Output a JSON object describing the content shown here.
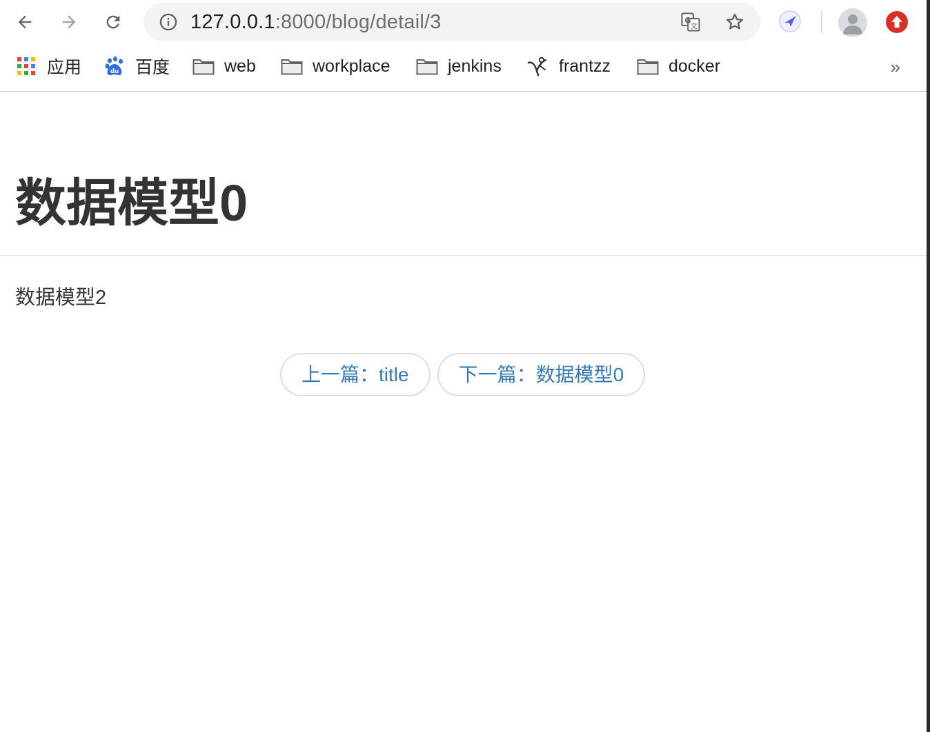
{
  "browser": {
    "url_host": "127.0.0.1",
    "url_rest": ":8000/blog/detail/3"
  },
  "bookmarks": {
    "items": [
      {
        "label": "应用",
        "icon": "apps-grid-icon"
      },
      {
        "label": "百度",
        "icon": "baidu-paw-icon"
      },
      {
        "label": "web",
        "icon": "folder-icon"
      },
      {
        "label": "workplace",
        "icon": "folder-icon"
      },
      {
        "label": "jenkins",
        "icon": "folder-icon"
      },
      {
        "label": "frantzz",
        "icon": "frantzz-logo-icon"
      },
      {
        "label": "docker",
        "icon": "folder-icon"
      }
    ],
    "more_label": "»"
  },
  "page": {
    "title": "数据模型0",
    "body": "数据模型2",
    "pager": {
      "previous_label": "上一篇：title",
      "next_label": "下一篇：数据模型0"
    }
  },
  "colors": {
    "link": "#337ab7",
    "text": "#333333",
    "update_badge": "#d93025"
  }
}
